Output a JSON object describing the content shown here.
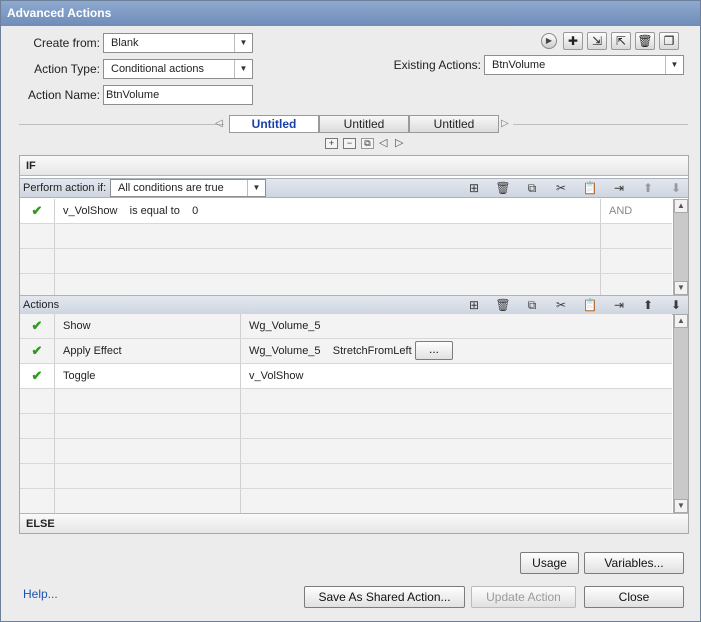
{
  "window": {
    "title": "Advanced Actions"
  },
  "form": {
    "create_from_label": "Create from:",
    "create_from_value": "Blank",
    "action_type_label": "Action Type:",
    "action_type_value": "Conditional actions",
    "action_name_label": "Action Name:",
    "action_name_value": "BtnVolume",
    "existing_actions_label": "Existing Actions:",
    "existing_actions_value": "BtnVolume"
  },
  "tabs": [
    {
      "label": "Untitled",
      "active": true
    },
    {
      "label": "Untitled",
      "active": false
    },
    {
      "label": "Untitled",
      "active": false
    }
  ],
  "if_section": {
    "header": "IF",
    "perform_label": "Perform action if:",
    "perform_value": "All conditions are true",
    "condition_rows": [
      {
        "checked": true,
        "variable": "v_VolShow",
        "operator": "is equal to",
        "value": "0",
        "logic": "AND"
      }
    ]
  },
  "actions_section": {
    "header": "Actions",
    "rows": [
      {
        "checked": true,
        "action": "Show",
        "target": "Wg_Volume_5",
        "extra": "",
        "has_button": false
      },
      {
        "checked": true,
        "action": "Apply Effect",
        "target": "Wg_Volume_5",
        "extra": "StretchFromLeft",
        "has_button": true
      },
      {
        "checked": true,
        "action": "Toggle",
        "target": "v_VolShow",
        "extra": "",
        "has_button": false
      }
    ],
    "more_button": "..."
  },
  "else_section": {
    "header": "ELSE"
  },
  "buttons": {
    "usage": "Usage",
    "variables": "Variables...",
    "save_shared": "Save As Shared Action...",
    "update": "Update Action",
    "close": "Close",
    "help": "Help..."
  }
}
